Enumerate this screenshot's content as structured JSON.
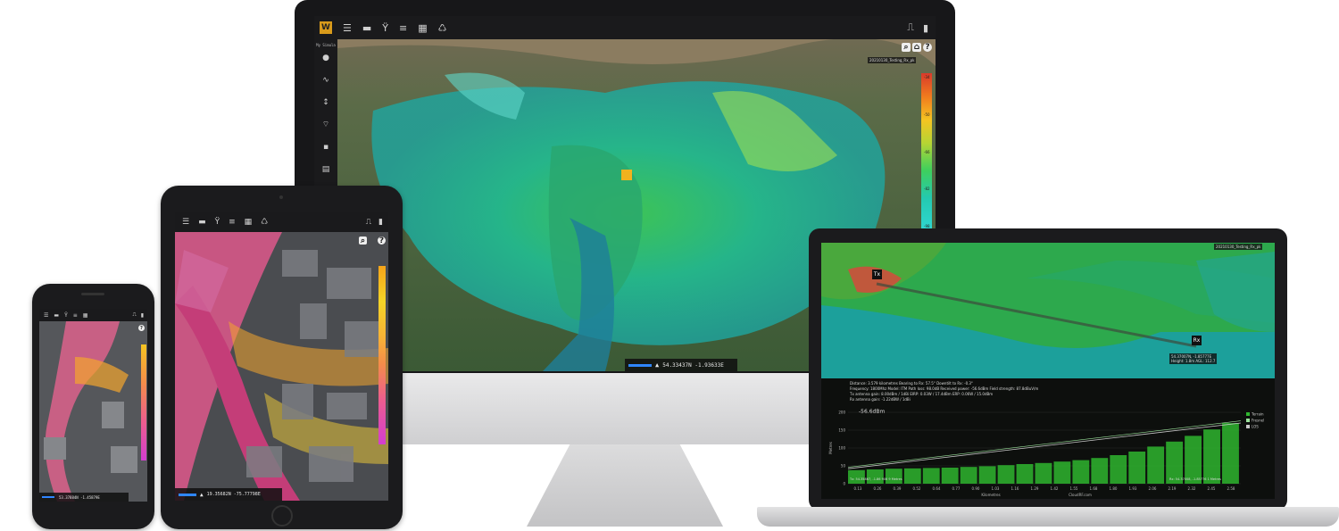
{
  "toolbar_icons": [
    "menu-icon",
    "ruler-icon",
    "antenna-icon",
    "database-icon",
    "grid-icon",
    "recycle-icon"
  ],
  "toolbar_right_icons": [
    "door-icon",
    "book-icon"
  ],
  "monitor": {
    "search_box": "My Simula",
    "layer_label": "20210130_Testing_Rx_pk",
    "coordinates": "54.33437N -1.93633E",
    "legend_ticks": [
      "-34",
      "-38",
      "-42",
      "-46",
      "-50",
      "-54",
      "-58",
      "-62",
      "-66",
      "-70",
      "-74",
      "-78",
      "-82",
      "-86",
      "-90",
      "-94",
      "-98"
    ]
  },
  "tablet": {
    "coordinates": "19.35682N -75.77798E"
  },
  "phone": {
    "coordinates": "53.37884N -1.45879E"
  },
  "laptop": {
    "layer_label": "20210130_Testing_Rx_pk",
    "tx_label": "Tx",
    "rx_label": "Rx",
    "rx_tooltip_line1": "54.37007N, -1.85777E",
    "rx_tooltip_line2": "Height: 1.8m AGL: 112.7",
    "info_line1": "Distance: 3.579 kilometres  Bearing to Rx: 57.5°  Downtilt to Rx: -0.3°",
    "info_line2": "Frequency: 1800Mhz  Model: ITM  Path loss: 98.0dB  Received power: -56.6dBm  Field strength: 87.8dBuV/m",
    "info_line3": "Tx antenna gain: 8.00dBm / 1dBi  EIRP: 0.03W / 17.4dBm  ERP: 0.06W / 15.0dBm",
    "info_line4": "Rx antenna gain: -1.22dBW / 1dBi",
    "readout": "-56.6dBm",
    "chart": {
      "type": "area",
      "ylabel": "Metres",
      "xlabel": "Kilometres",
      "footer": "CloudRF.com",
      "y_ticks": [
        "200",
        "150",
        "100",
        "50",
        "0"
      ],
      "x_ticks": [
        "0.13",
        "0.26",
        "0.39",
        "0.52",
        "0.64",
        "0.77",
        "0.90",
        "1.03",
        "1.16",
        "1.29",
        "1.42",
        "1.55",
        "1.68",
        "1.80",
        "1.93",
        "2.06",
        "2.19",
        "2.32",
        "2.45",
        "2.58"
      ],
      "ylim": [
        0,
        200
      ],
      "legend": [
        "Terrain",
        "Fresnel",
        "LOS"
      ],
      "colors": {
        "terrain": "#2fb52f",
        "fresnel": "#9be29b",
        "los": "#c8c8c8"
      },
      "tx_note": "Tx: 54.35867, -1.86 906  9 Metres",
      "rx_note": "Rx: 54.37008, -1.85776  1 Metres",
      "terrain_values": [
        38,
        40,
        42,
        43,
        44,
        45,
        47,
        49,
        52,
        55,
        58,
        62,
        66,
        72,
        80,
        90,
        104,
        118,
        134,
        152,
        170
      ]
    }
  }
}
